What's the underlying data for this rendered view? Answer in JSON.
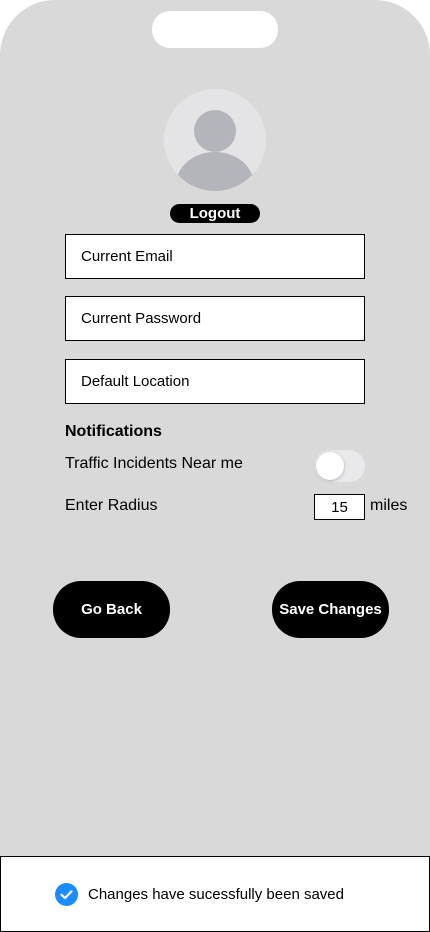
{
  "profile": {
    "logout_label": "Logout",
    "avatar_icon": "user-avatar-icon"
  },
  "form": {
    "email_placeholder": "Current Email",
    "password_placeholder": "Current Password",
    "location_placeholder": "Default Location"
  },
  "notifications": {
    "title": "Notifications",
    "traffic_label": "Traffic Incidents Near me",
    "traffic_enabled": false,
    "radius_label": "Enter Radius",
    "radius_value": "15",
    "radius_unit": "miles"
  },
  "actions": {
    "back_label": "Go Back",
    "save_label": "Save Changes"
  },
  "toast": {
    "message": "Changes have sucessfully been saved",
    "icon": "check-circle-icon",
    "accent": "#1a8cff"
  }
}
